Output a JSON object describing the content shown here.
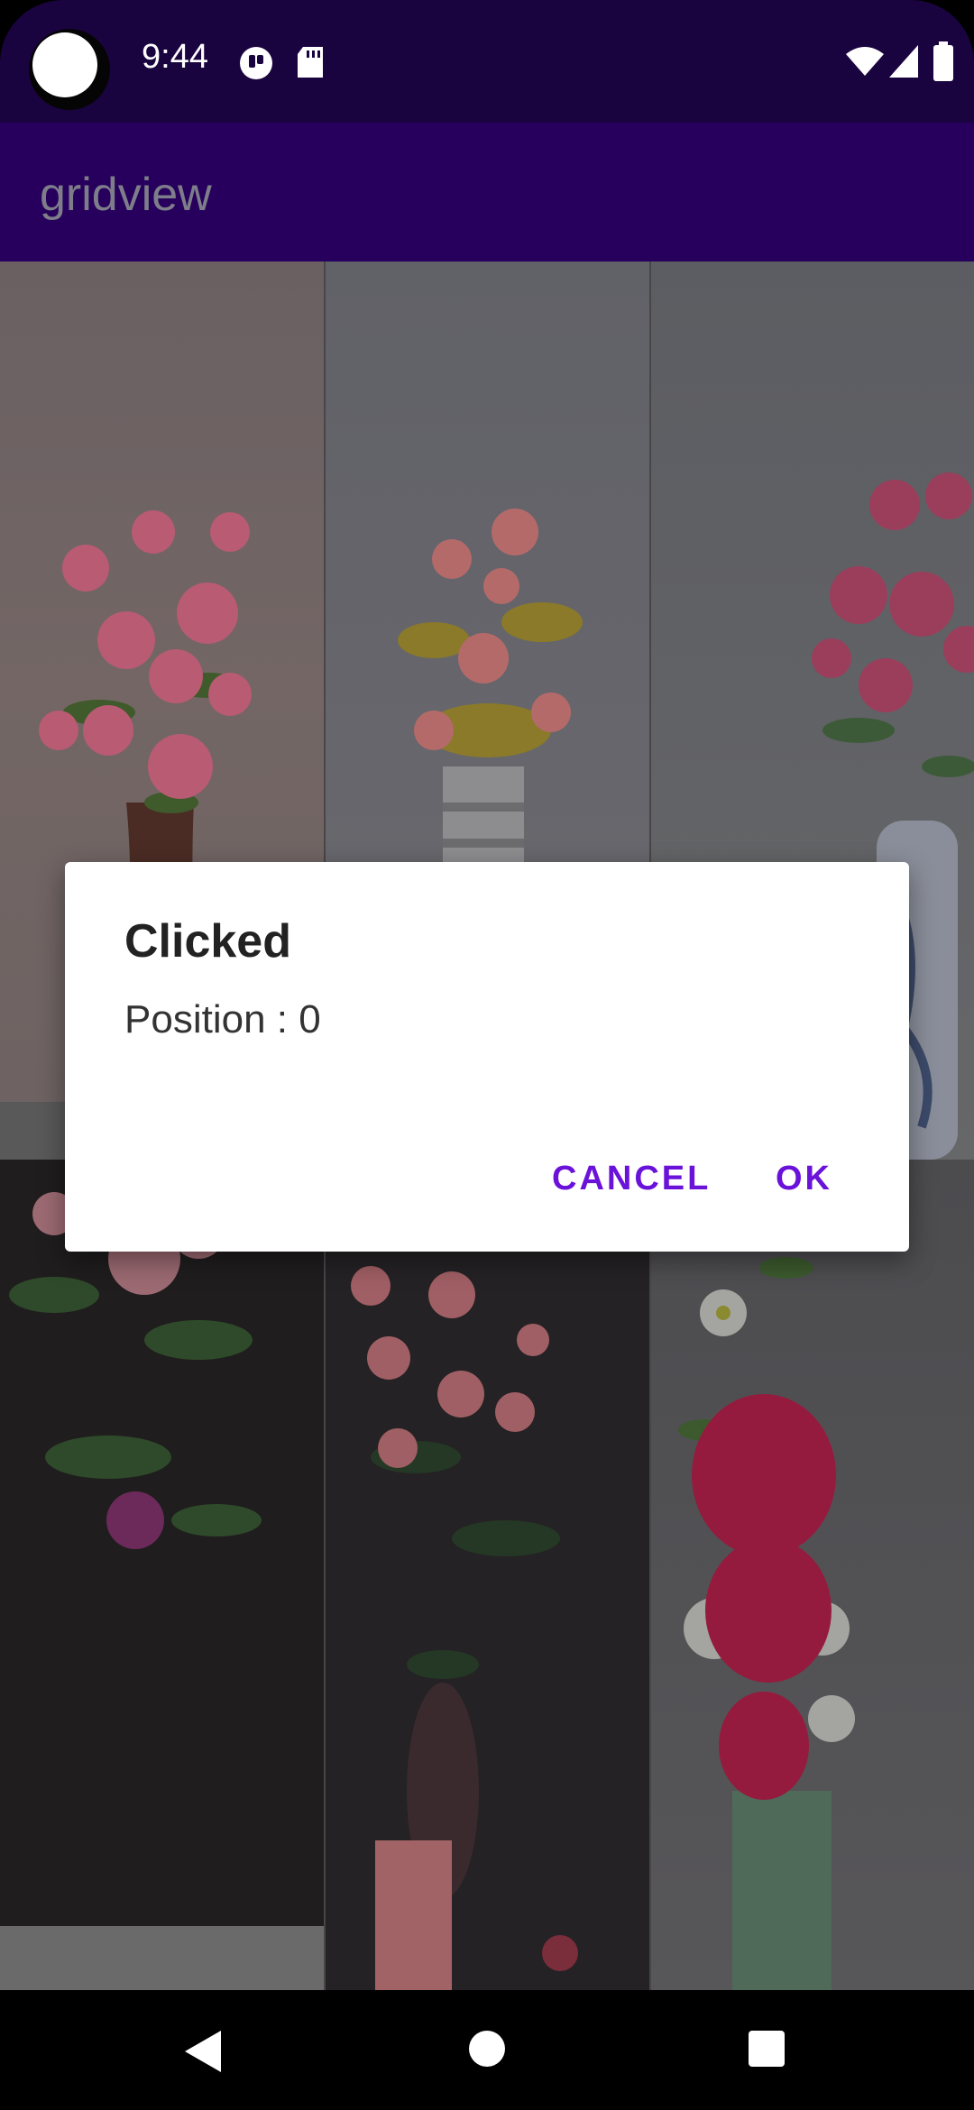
{
  "status_bar": {
    "time": "9:44",
    "left_icons": [
      "notification-app-icon",
      "sd-card-icon"
    ],
    "right_icons": [
      "wifi-icon",
      "signal-icon",
      "battery-icon"
    ]
  },
  "app_bar": {
    "title": "gridview"
  },
  "grid": {
    "items": [
      {
        "icon": "flower-image-pink-roses"
      },
      {
        "icon": "flower-image-roses-tin-vase"
      },
      {
        "icon": "flower-image-peonies-blue-vase"
      },
      {
        "icon": "flower-image-roses-dark"
      },
      {
        "icon": "flower-image-roses-vase-dark"
      },
      {
        "icon": "flower-image-red-peony-daisies"
      }
    ]
  },
  "dialog": {
    "title": "Clicked",
    "message": "Position : 0",
    "cancel_label": "CANCEL",
    "ok_label": "OK"
  },
  "nav_bar": {
    "icons": [
      "back-icon",
      "home-icon",
      "recents-icon"
    ]
  }
}
